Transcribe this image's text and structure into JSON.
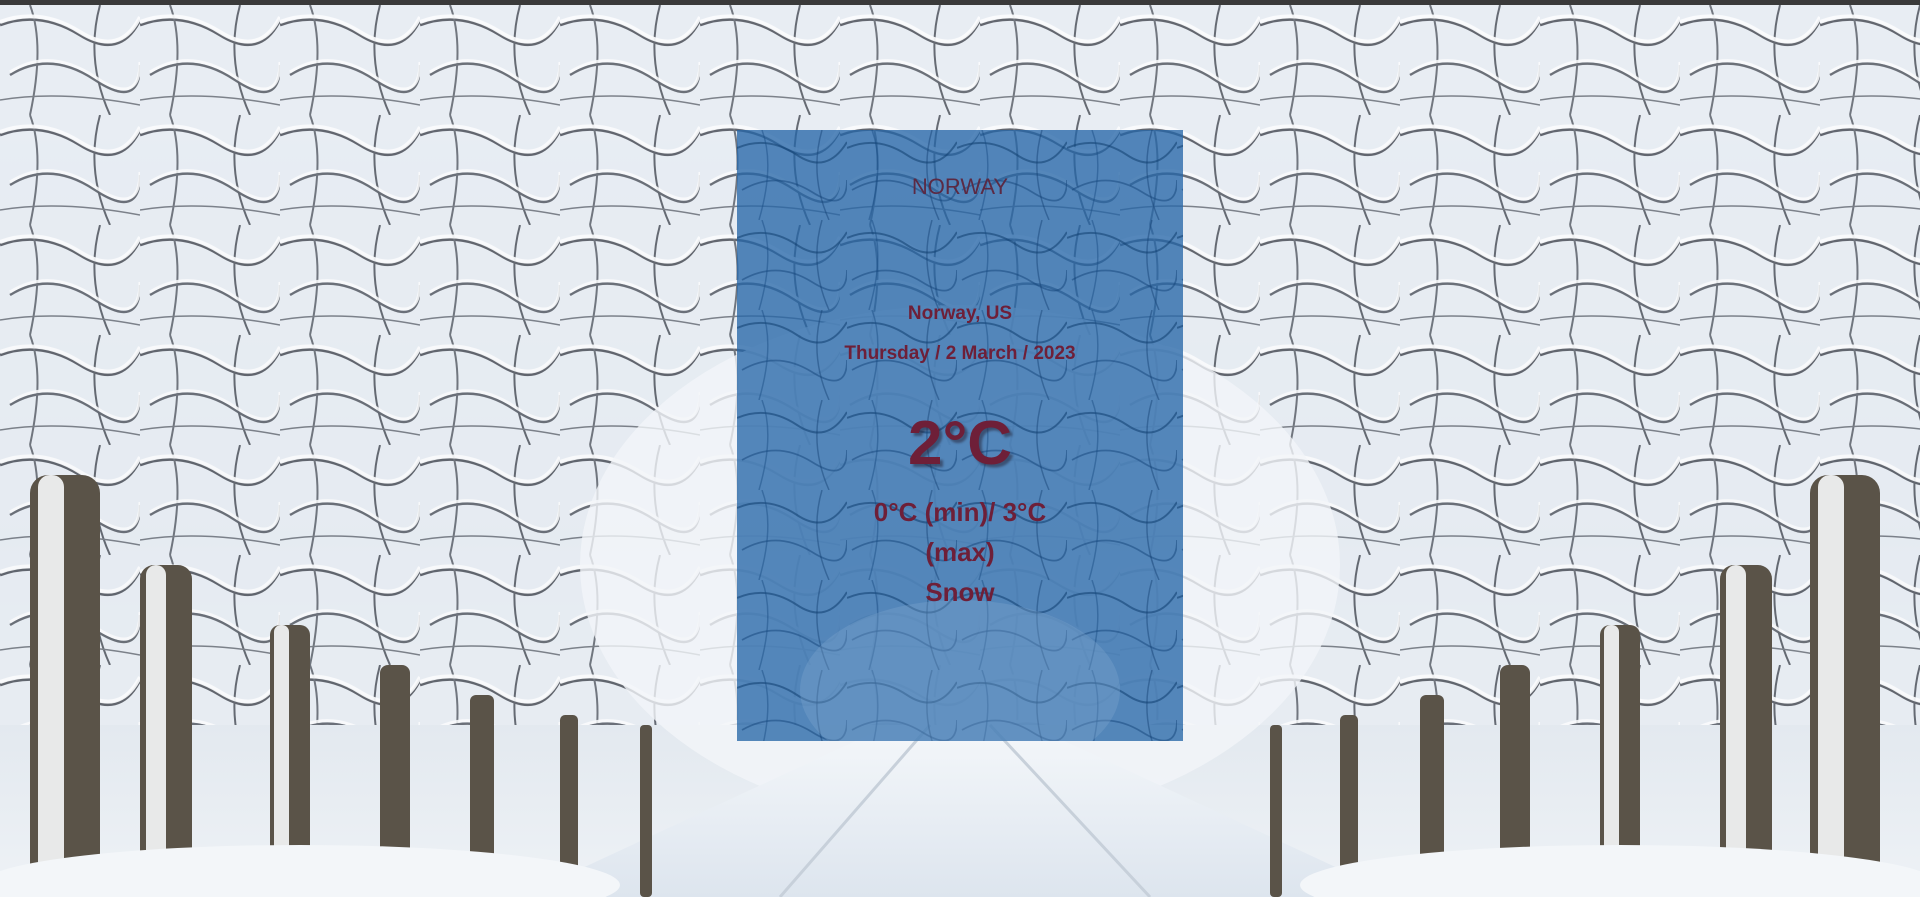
{
  "search": {
    "value": "NORWAY",
    "placeholder": ""
  },
  "weather": {
    "location": "Norway, US",
    "date": "Thursday / 2 March / 2023",
    "temperature": "2°C",
    "min_max": "0°C (min)/ 3°C (max)",
    "condition": "Snow"
  },
  "colors": {
    "card_background": "#2666a8",
    "text_accent": "#6e1f38"
  }
}
